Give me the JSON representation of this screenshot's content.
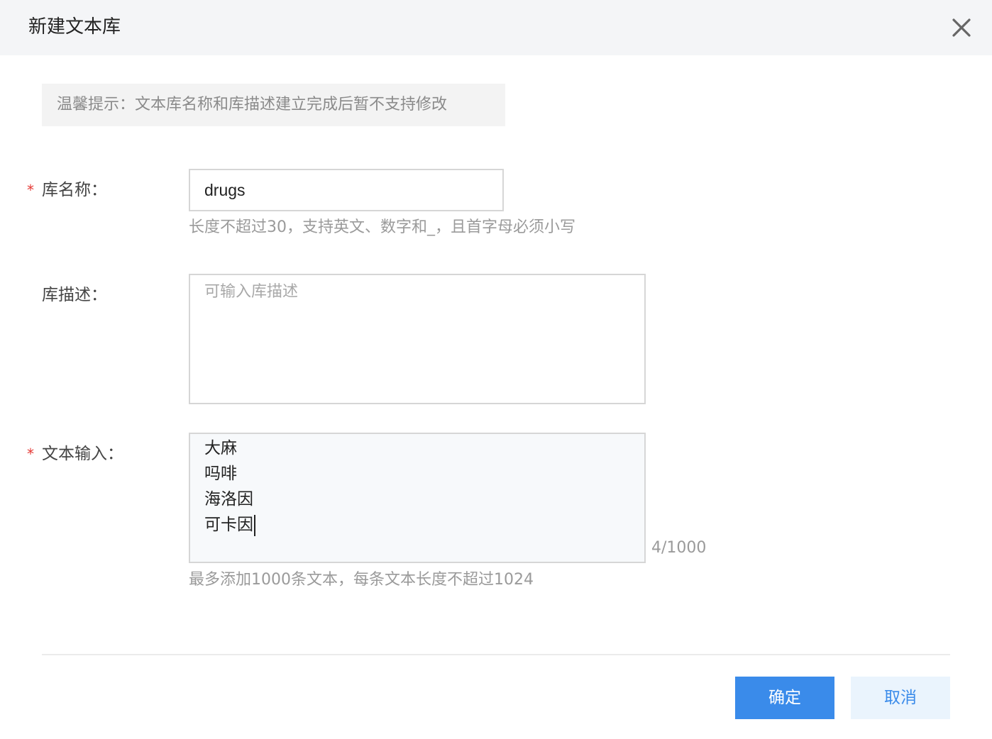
{
  "dialog": {
    "title": "新建文本库",
    "close_icon": "close-icon"
  },
  "tip": {
    "text": "温馨提示：文本库名称和库描述建立完成后暂不支持修改"
  },
  "form": {
    "name": {
      "required_mark": "*",
      "label": "库名称：",
      "value": "drugs",
      "hint": "长度不超过30，支持英文、数字和_，且首字母必须小写"
    },
    "description": {
      "label": "库描述：",
      "placeholder": "可输入库描述",
      "value": ""
    },
    "text_input": {
      "required_mark": "*",
      "label": "文本输入：",
      "lines": [
        "大麻",
        "吗啡",
        "海洛因",
        "可卡因"
      ],
      "counter": "4/1000",
      "hint": "最多添加1000条文本，每条文本长度不超过1024"
    }
  },
  "footer": {
    "ok_label": "确定",
    "cancel_label": "取消",
    "ok_color": "#3a8bea"
  }
}
